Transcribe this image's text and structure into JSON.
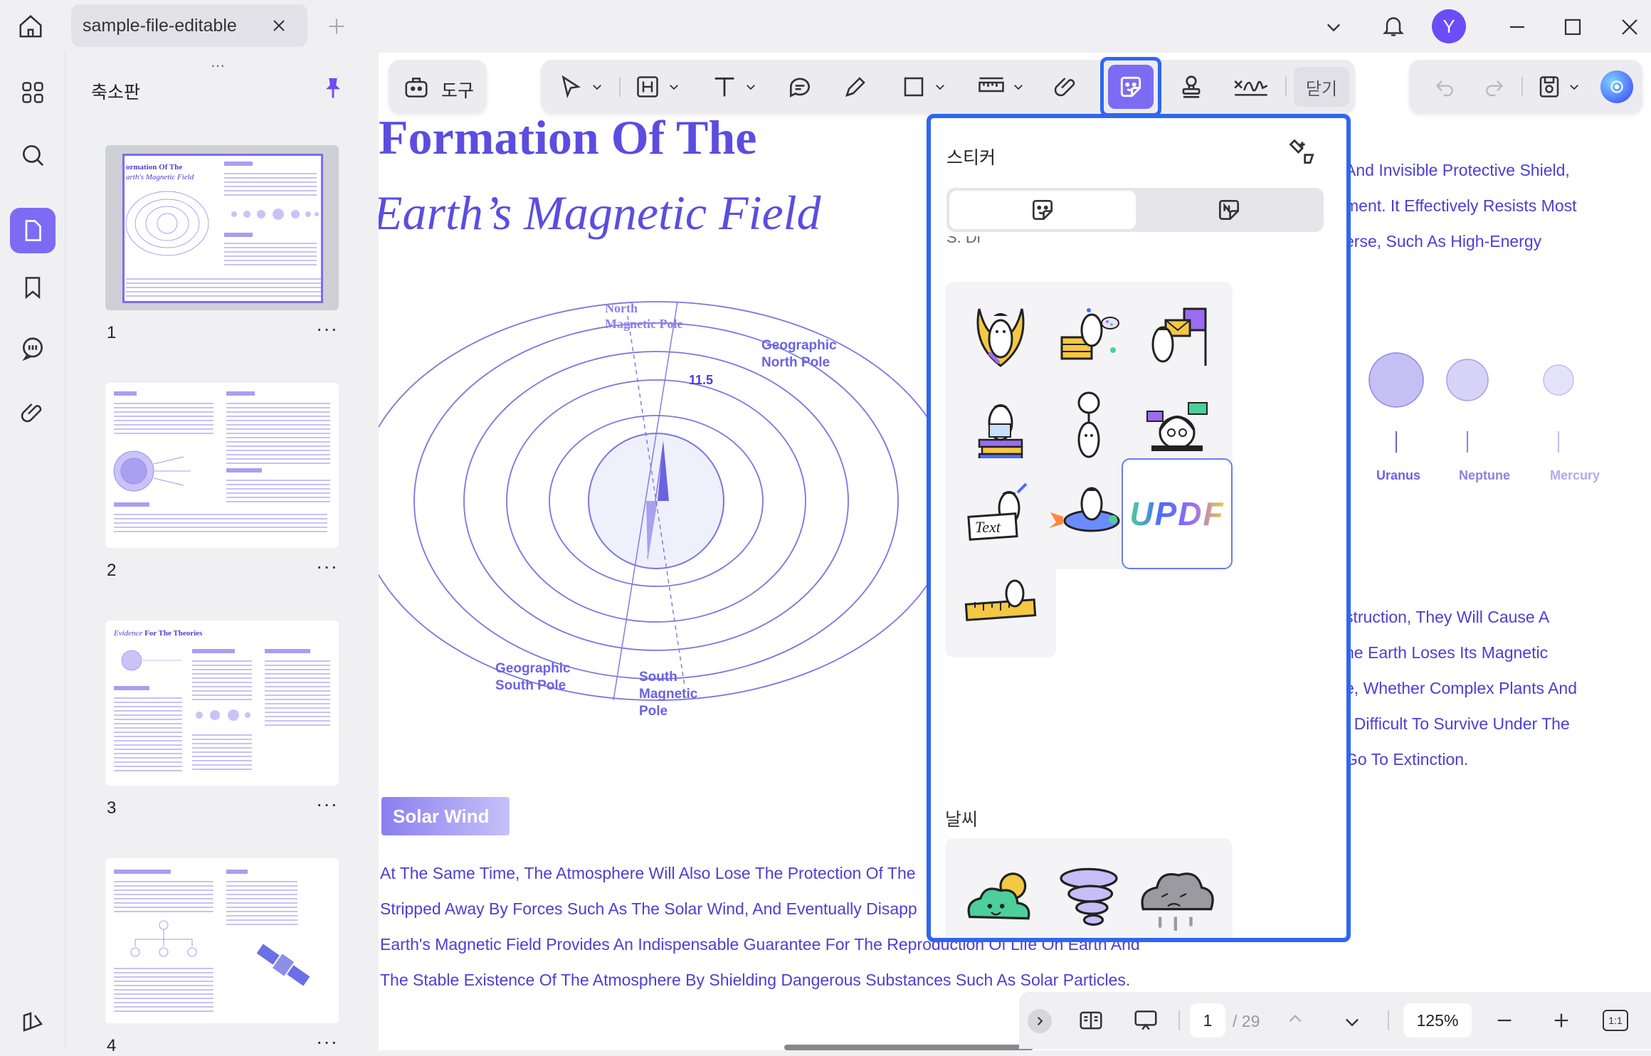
{
  "titlebar": {
    "tab_title": "sample-file-editable",
    "avatar_initial": "Y"
  },
  "panel": {
    "title": "축소판",
    "pages": [
      {
        "num": "1",
        "more": "···"
      },
      {
        "num": "2",
        "more": "···"
      },
      {
        "num": "3",
        "more": "···"
      },
      {
        "num": "4",
        "more": "···"
      }
    ],
    "thumb1_title_a": "ormation Of The",
    "thumb1_title_b": "arth's Magnetic Field",
    "thumb3_title_a": "Evidence",
    "thumb3_title_b": " For The Theories"
  },
  "tools": {
    "tools_label": "도구",
    "close_label": "닫기"
  },
  "doc": {
    "title_line1": "Formation Of The",
    "title_line2": "Earth’s Magnetic Field",
    "label_north_magnetic": [
      "North",
      "Magnetic Pole"
    ],
    "label_geo_north": [
      "Geographic",
      "North Pole"
    ],
    "label_geo_south": [
      "Geographic",
      "South Pole"
    ],
    "label_south_magnetic": [
      "South",
      "Magnetic",
      "Pole"
    ],
    "angle_label": "11.5",
    "right_text_top": [
      "And Invisible Protective Shield,",
      "ment. It Effectively Resists Most",
      "erse, Such As High-Energy"
    ],
    "planets": [
      "Uranus",
      "Neptune",
      "Mercury"
    ],
    "right_text_mid": [
      "struction, They Will Cause A",
      "he Earth Loses Its Magnetic",
      "e, Whether Complex Plants And",
      "t Difficult To Survive Under The",
      "Go To Extinction."
    ],
    "solar_wind_label": "Solar Wind",
    "bottom_text": [
      "At The Same Time, The Atmosphere Will Also Lose The Protection Of The",
      "Stripped Away By Forces Such As The Solar Wind, And Eventually Disapp",
      "Earth's Magnetic Field Provides An Indispensable Guarantee For The Reproduction Of Life On Earth And",
      "The Stable Existence Of The Atmosphere By Shielding Dangerous Substances Such As Solar Particles."
    ]
  },
  "sticker_panel": {
    "title": "스티커",
    "section_partial": "S. Di",
    "weather_title": "날씨",
    "updf_sticker_text": "UPDF",
    "text_sticker_text": "Text"
  },
  "bottombar": {
    "page_current": "1",
    "page_total": "/ 29",
    "zoom": "125%",
    "fit_label": "1:1"
  },
  "colors": {
    "accent": "#7e6bf4",
    "doc_text": "#4b3fd4",
    "highlight_border": "#2f66f0"
  }
}
